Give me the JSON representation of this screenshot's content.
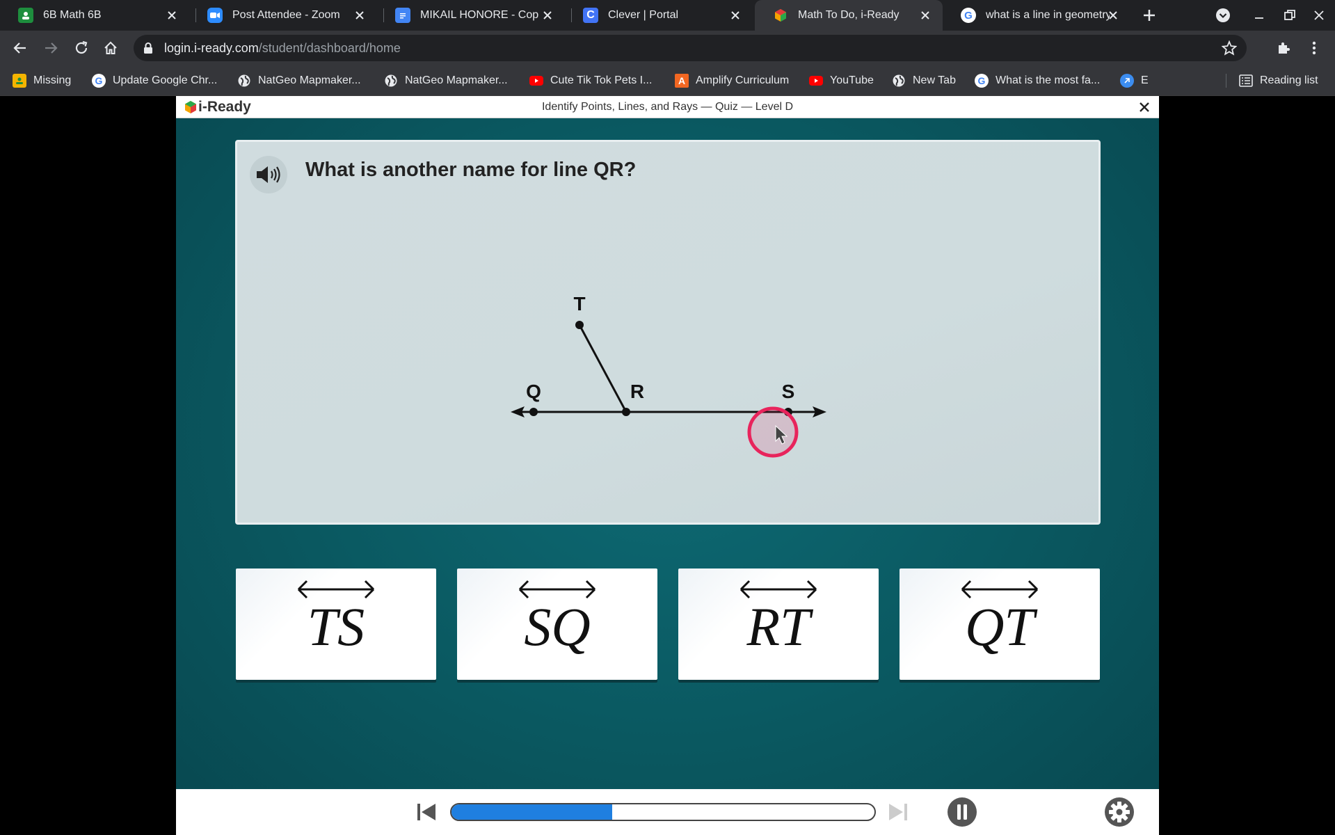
{
  "browser": {
    "tabs": [
      {
        "title": "6B Math 6B",
        "icon": "classroom-icon",
        "active": false
      },
      {
        "title": "Post Attendee - Zoom",
        "icon": "zoom-icon",
        "active": false
      },
      {
        "title": "MIKAIL HONORE - Copy o",
        "icon": "docs-icon",
        "active": false
      },
      {
        "title": "Clever | Portal",
        "icon": "clever-icon",
        "active": false
      },
      {
        "title": "Math To Do, i-Ready",
        "icon": "iready-icon",
        "active": true
      },
      {
        "title": "what is a line in geometry",
        "icon": "google-icon",
        "active": false
      }
    ],
    "url_host": "login.i-ready.com",
    "url_path": "/student/dashboard/home",
    "bookmarks": [
      {
        "label": "Missing",
        "icon": "classroom-icon"
      },
      {
        "label": "Update Google Chr...",
        "icon": "google-icon"
      },
      {
        "label": "NatGeo Mapmaker...",
        "icon": "globe-icon"
      },
      {
        "label": "NatGeo Mapmaker...",
        "icon": "globe-icon"
      },
      {
        "label": "Cute Tik Tok Pets I...",
        "icon": "youtube-icon"
      },
      {
        "label": "Amplify Curriculum",
        "icon": "amplify-icon"
      },
      {
        "label": "YouTube",
        "icon": "youtube-icon"
      },
      {
        "label": "New Tab",
        "icon": "globe-icon"
      },
      {
        "label": "What is the most fa...",
        "icon": "google-icon"
      },
      {
        "label": "E",
        "icon": "edge-icon"
      }
    ],
    "reading_list": "Reading list"
  },
  "lesson": {
    "logo_text": "i-Ready",
    "title": "Identify Points, Lines, and Rays — Quiz — Level D",
    "question": "What is another name for line QR?",
    "diagram_points": {
      "T": "T",
      "Q": "Q",
      "R": "R",
      "S": "S"
    },
    "choices": [
      {
        "label": "TS"
      },
      {
        "label": "SQ"
      },
      {
        "label": "RT"
      },
      {
        "label": "QT"
      }
    ],
    "progress": 0.38
  },
  "colors": {
    "accent": "#1f7fe0",
    "teal_bg": "#0a5860",
    "cursor_ring": "#e8245c"
  }
}
